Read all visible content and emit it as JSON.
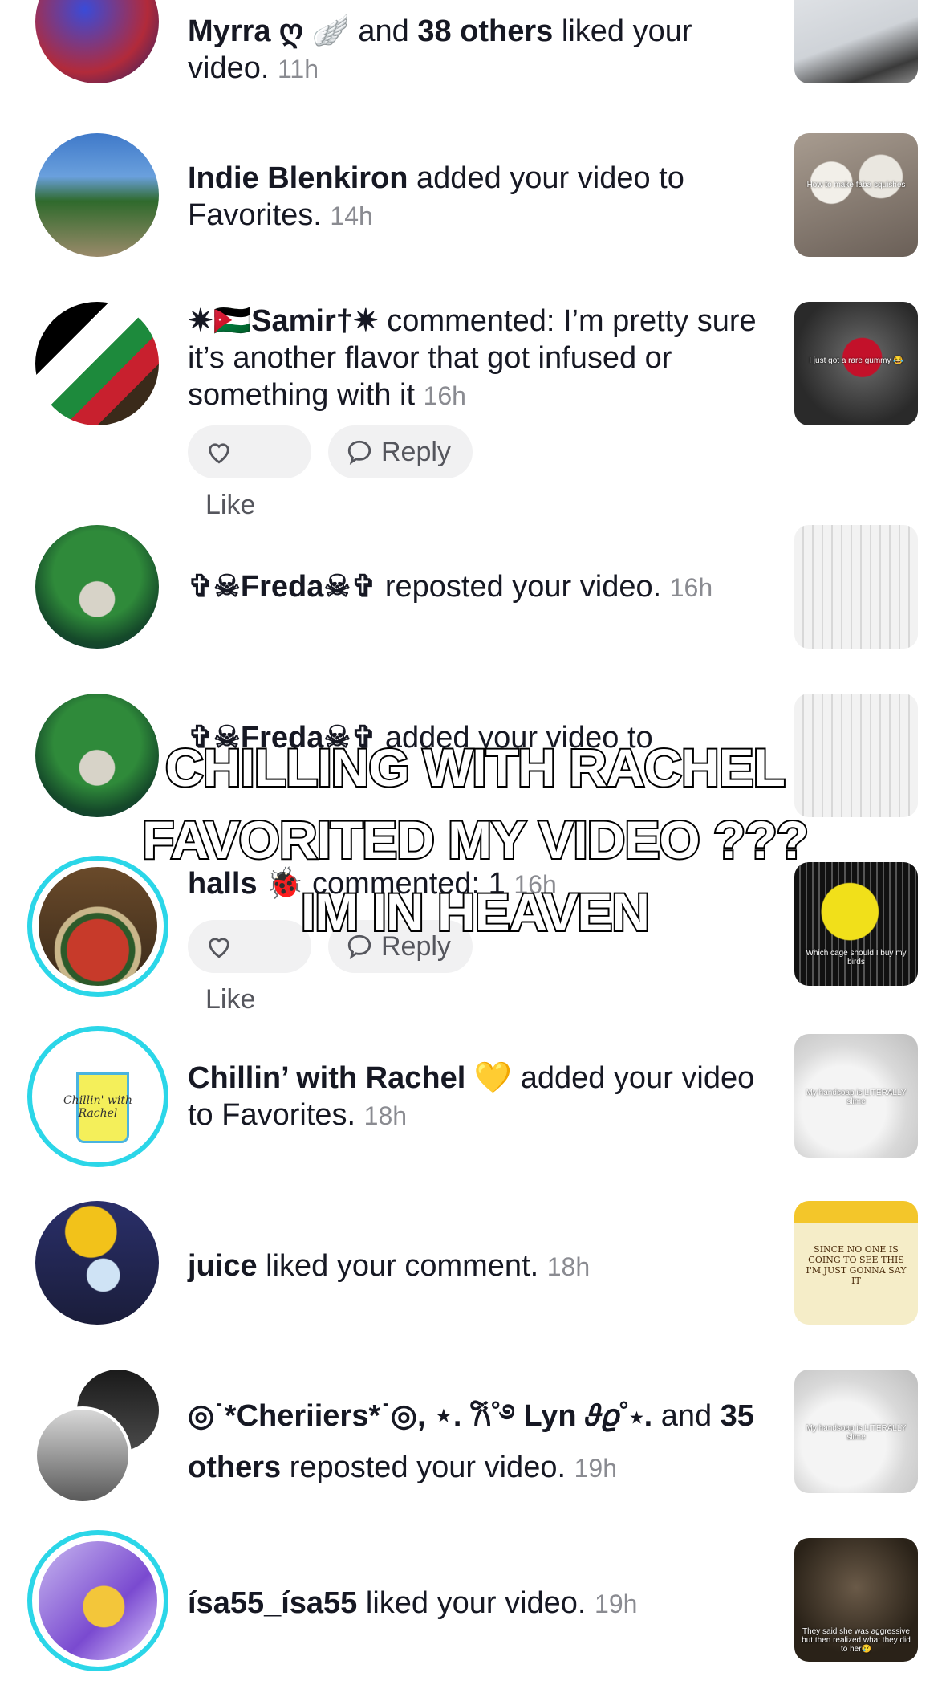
{
  "notifications": [
    {
      "segments": [
        {
          "t": "Myrra ღ 🪽",
          "b": true
        },
        {
          "t": " and ",
          "b": false
        },
        {
          "t": "38 others",
          "b": true
        },
        {
          "t": " liked your video.",
          "b": false
        }
      ],
      "time": "11h",
      "thumb_caption": ""
    },
    {
      "segments": [
        {
          "t": "Indie Blenkiron",
          "b": true
        },
        {
          "t": " added your video to Favorites.",
          "b": false
        }
      ],
      "time": "14h",
      "thumb_caption": "How to make faba squishes"
    },
    {
      "segments": [
        {
          "t": "✷🇯🇴Samir†✷",
          "b": true
        },
        {
          "t": " commented: I’m pretty sure it’s another flavor that got infused or something with it",
          "b": false
        }
      ],
      "time": "16h",
      "thumb_caption": "I just got a rare gummy 😂"
    },
    {
      "segments": [
        {
          "t": "✞☠Freda☠✞",
          "b": true
        },
        {
          "t": " reposted your video.",
          "b": false
        }
      ],
      "time": "16h",
      "thumb_caption": ""
    },
    {
      "segments": [
        {
          "t": "✞☠Freda☠✞",
          "b": true
        },
        {
          "t": " added your video to",
          "b": false
        }
      ],
      "time": "",
      "thumb_caption": ""
    },
    {
      "segments": [
        {
          "t": "halls 🐞",
          "b": true
        },
        {
          "t": " commented: 1",
          "b": false
        }
      ],
      "time": "16h",
      "thumb_caption": "Which cage should I buy my birds"
    },
    {
      "segments": [
        {
          "t": "Chillin’ with Rachel 💛",
          "b": true
        },
        {
          "t": " added your video to Favorites.",
          "b": false
        }
      ],
      "time": "18h",
      "thumb_caption": "My handsoap is LITERALLY slime"
    },
    {
      "segments": [
        {
          "t": "juice",
          "b": true
        },
        {
          "t": " liked your comment.",
          "b": false
        }
      ],
      "time": "18h",
      "thumb_caption": "SINCE NO ONE IS GOING TO SEE THIS I'M JUST GONNA SAY IT"
    },
    {
      "segments": [
        {
          "t": "◎˙*Cheriiers*˙◎, ⋆. 𐙚˚࿔ Lyn 𝜗𝜚˚⋆.",
          "b": true
        },
        {
          "t": " and ",
          "b": false
        },
        {
          "t": "35 others",
          "b": true
        },
        {
          "t": " reposted your video.",
          "b": false
        }
      ],
      "time": "19h",
      "thumb_caption": "My handsoap is LITERALLY slime"
    },
    {
      "segments": [
        {
          "t": "ísa55_ísa55",
          "b": true
        },
        {
          "t": " liked your video.",
          "b": false
        }
      ],
      "time": "19h",
      "thumb_caption": "They said she was aggressive but then realized what they did to her😢"
    }
  ],
  "actions": {
    "like_label": "Like",
    "reply_label": "Reply"
  },
  "avatar_text": {
    "chillin": "Chillin' with Rachel"
  },
  "overlay": {
    "line1": "CHILLING WITH RACHEL",
    "line2": "FAVORITED MY VIDEO ???",
    "line3": "IM IN HEAVEN"
  }
}
